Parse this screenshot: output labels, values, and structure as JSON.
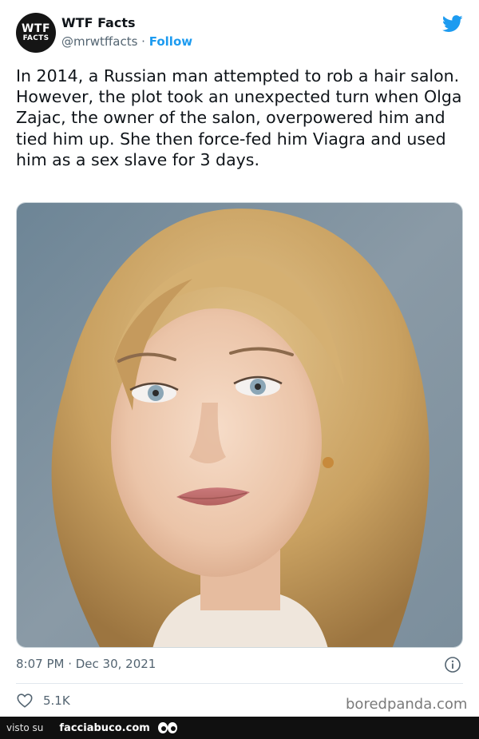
{
  "tweet": {
    "avatar": {
      "line1": "WTF",
      "line2": "FACTS"
    },
    "display_name": "WTF Facts",
    "handle": "@mrwtffacts",
    "separator": " · ",
    "follow_label": "Follow",
    "text": "In 2014, a Russian man attempted to rob a hair salon. However, the plot took an unexpected turn when Olga Zajac, the owner of the salon, overpowered him and tied him up. She then force-fed him Viagra and used him as a sex slave for 3 days.",
    "timestamp": "8:07 PM · Dec 30, 2021",
    "likes": "5.1K",
    "watermark": "boredpanda.com"
  },
  "footer": {
    "prefix": "visto su",
    "site": "facciabuco.com"
  },
  "icons": {
    "platform": "twitter-bird-icon",
    "info": "info-icon",
    "like": "heart-icon",
    "logo": "eyes-icon"
  },
  "colors": {
    "accent": "#1d9bf0",
    "secondary_text": "#536471",
    "footer_bg": "#101010"
  }
}
